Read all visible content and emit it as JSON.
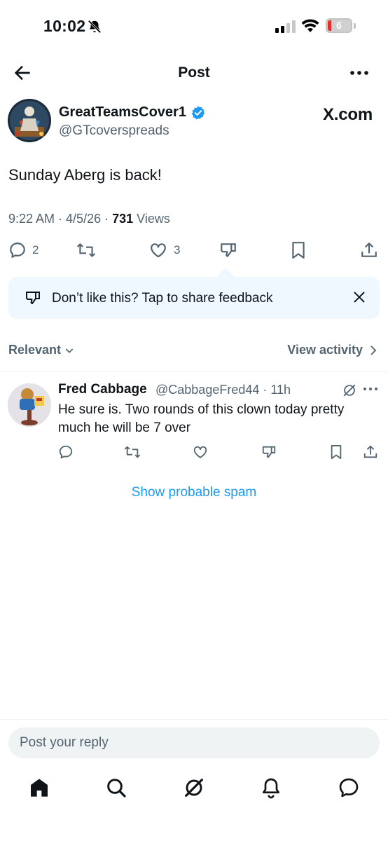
{
  "status_bar": {
    "time": "10:02",
    "battery_level": "6"
  },
  "nav": {
    "title": "Post"
  },
  "tweet": {
    "author_name": "GreatTeamsCover1",
    "author_handle": "@GTcoverspreads",
    "source": "X.com",
    "text": "Sunday Aberg is back!",
    "time": "9:22 AM",
    "date": "4/5/26",
    "views_count": "731",
    "views_label": "Views",
    "replies_count": "2",
    "likes_count": "3"
  },
  "feedback": {
    "text": "Don’t like this? Tap to share feedback"
  },
  "sort": {
    "label": "Relevant",
    "view_activity": "View activity"
  },
  "replies": [
    {
      "name": "Fred Cabbage",
      "handle": "@CabbageFred44",
      "time": "11h",
      "text": "He sure is. Two rounds of this clown today pretty much he will be 7 over"
    }
  ],
  "spam_link": "Show probable spam",
  "compose": {
    "placeholder": "Post your reply"
  },
  "colors": {
    "accent": "#1d9bf0",
    "secondary_text": "#536471",
    "feedback_bg": "#eef8fe"
  },
  "icons": [
    "back-arrow-icon",
    "more-icon",
    "verified-icon",
    "reply-icon",
    "repost-icon",
    "like-icon",
    "dislike-icon",
    "bookmark-icon",
    "share-icon",
    "close-icon",
    "grok-icon",
    "home-icon",
    "search-icon",
    "notifications-icon",
    "messages-icon"
  ]
}
